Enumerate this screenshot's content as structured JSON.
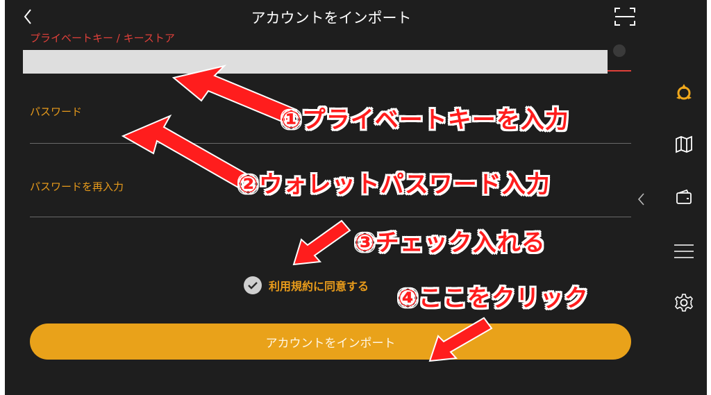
{
  "header": {
    "title": "アカウントをインポート",
    "back_icon": "chevron-left-icon",
    "scan_icon": "scan-icon"
  },
  "form": {
    "private_key_label": "プライベートキー / キーストア",
    "password_label": "パスワード",
    "password_confirm_label": "パスワードを再入力"
  },
  "agreement": {
    "label": "利用規約に同意する",
    "checked": true
  },
  "import_button": {
    "label": "アカウントをインポート"
  },
  "sidebar": {
    "icons": [
      "logo-icon",
      "map-icon",
      "wallet-icon",
      "menu-icon",
      "gear-icon"
    ]
  },
  "annotations": {
    "step1": "①プライベートキーを入力",
    "step2": "②ウォレットパスワード入力",
    "step3": "③チェック入れる",
    "step4": "④ここをクリック"
  },
  "colors": {
    "background": "#1e1e1e",
    "accent": "#e9a21a",
    "label_orange": "#e89b1b",
    "label_red": "#e0403a",
    "annotation_red": "#ff1d1d"
  }
}
